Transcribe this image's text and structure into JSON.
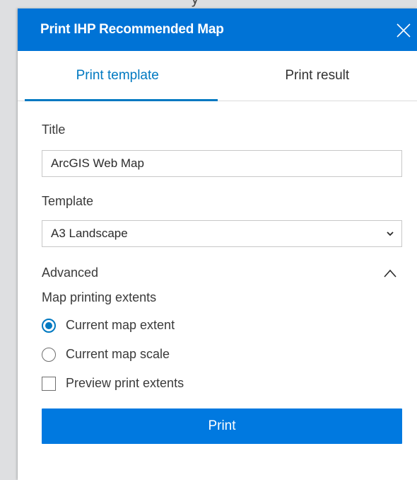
{
  "colors": {
    "header_bg": "#0073d6",
    "accent": "#0079c1",
    "button_bg": "#0079e0"
  },
  "map_overlay_glyph": "y",
  "panel": {
    "title": "Print IHP Recommended Map",
    "close_icon": "close-icon"
  },
  "tabs": [
    {
      "label": "Print template",
      "active": true
    },
    {
      "label": "Print result",
      "active": false
    }
  ],
  "form": {
    "title_label": "Title",
    "title_value": "ArcGIS Web Map",
    "template_label": "Template",
    "template_value": "A3 Landscape",
    "advanced_label": "Advanced",
    "advanced_expanded": true,
    "extents_label": "Map printing extents",
    "options": [
      {
        "label": "Current map extent",
        "selected": true
      },
      {
        "label": "Current map scale",
        "selected": false
      }
    ],
    "preview_label": "Preview print extents",
    "preview_checked": false,
    "print_button": "Print"
  }
}
